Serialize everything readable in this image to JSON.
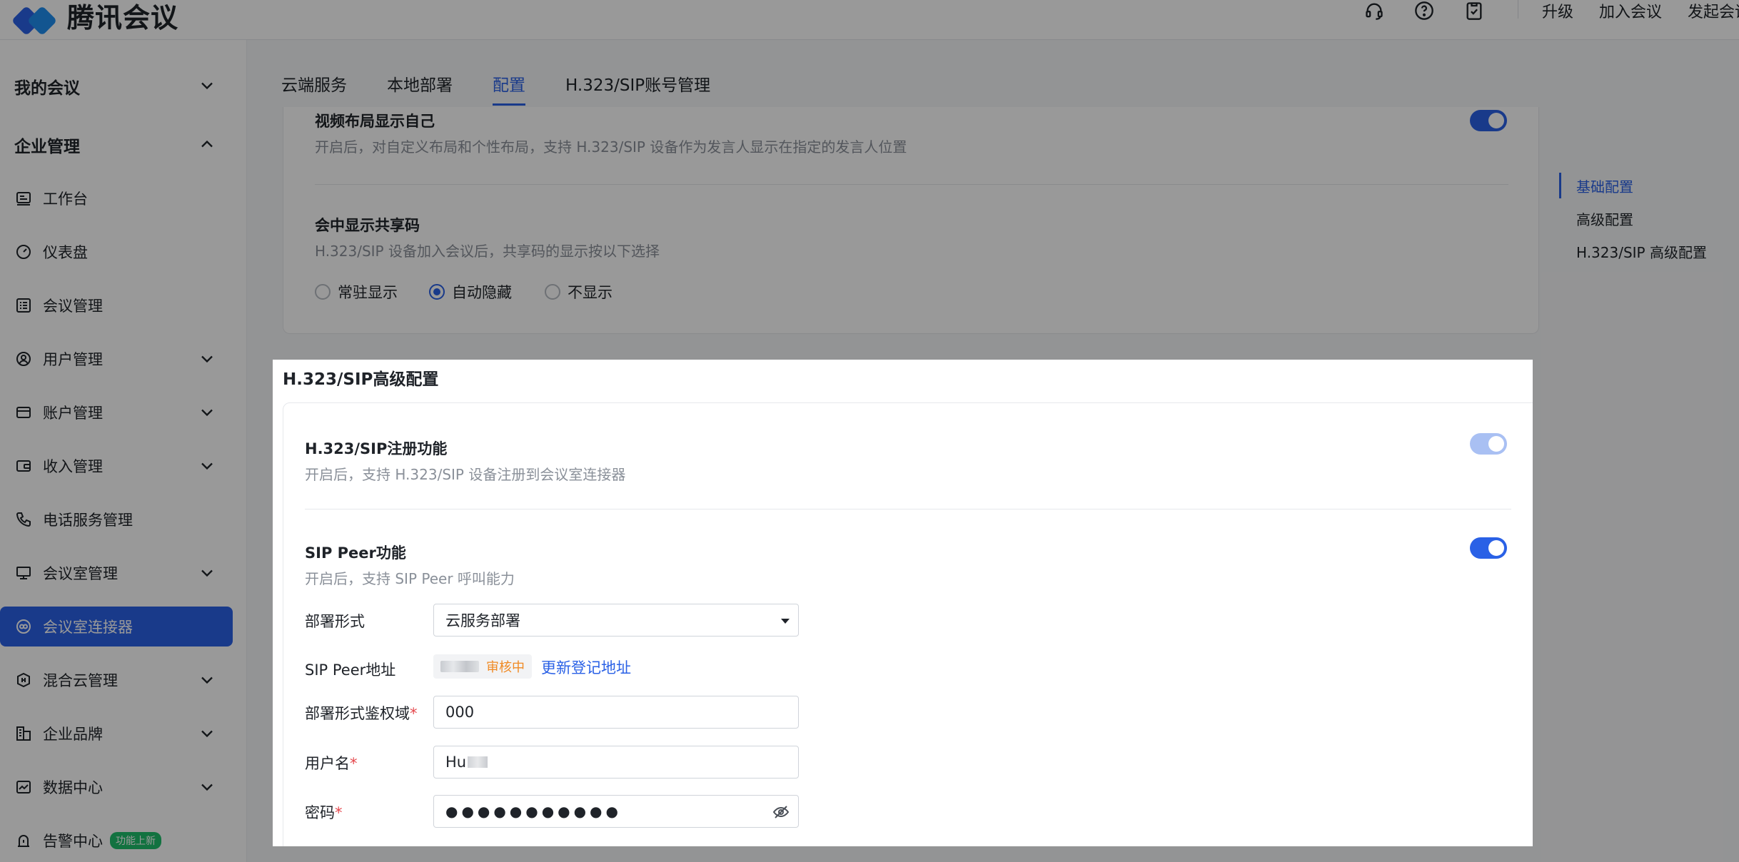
{
  "header": {
    "app_name": "腾讯会议",
    "links": [
      "升级",
      "加入会议",
      "发起会议"
    ],
    "icons": [
      "headset-icon",
      "help-icon",
      "clipboard-check-icon"
    ]
  },
  "sidebar": {
    "section_my": "我的会议",
    "section_enterprise": "企业管理",
    "items": [
      {
        "label": "工作台",
        "icon": "workbench-icon",
        "expandable": false
      },
      {
        "label": "仪表盘",
        "icon": "dashboard-icon",
        "expandable": false
      },
      {
        "label": "会议管理",
        "icon": "list-icon",
        "expandable": false
      },
      {
        "label": "用户管理",
        "icon": "user-icon",
        "expandable": true
      },
      {
        "label": "账户管理",
        "icon": "card-icon",
        "expandable": true
      },
      {
        "label": "收入管理",
        "icon": "wallet-icon",
        "expandable": true
      },
      {
        "label": "电话服务管理",
        "icon": "phone-icon",
        "expandable": false
      },
      {
        "label": "会议室管理",
        "icon": "monitor-icon",
        "expandable": true
      },
      {
        "label": "会议室连接器",
        "icon": "link-icon",
        "expandable": false,
        "active": true
      },
      {
        "label": "混合云管理",
        "icon": "hybrid-cloud-icon",
        "expandable": true
      },
      {
        "label": "企业品牌",
        "icon": "brand-icon",
        "expandable": true
      },
      {
        "label": "数据中心",
        "icon": "chart-icon",
        "expandable": true
      },
      {
        "label": "告警中心",
        "icon": "alarm-icon",
        "expandable": false,
        "badge": "功能上新"
      }
    ]
  },
  "tabs": [
    {
      "label": "云端服务",
      "active": false
    },
    {
      "label": "本地部署",
      "active": false
    },
    {
      "label": "配置",
      "active": true
    },
    {
      "label": "H.323/SIP账号管理",
      "active": false
    }
  ],
  "basic": {
    "video_layout_title": "视频布局显示自己",
    "video_layout_desc": "开启后，对自定义布局和个性布局，支持 H.323/SIP 设备作为发言人显示在指定的发言人位置",
    "video_layout_on": true,
    "share_code_title": "会中显示共享码",
    "share_code_desc": "H.323/SIP 设备加入会议后，共享码的显示按以下选择",
    "share_code_options": [
      "常驻显示",
      "自动隐藏",
      "不显示"
    ],
    "share_code_selected": "自动隐藏"
  },
  "toc": {
    "items": [
      "基础配置",
      "高级配置",
      "H.323/SIP 高级配置"
    ],
    "active": "基础配置"
  },
  "advanced": {
    "section_title": "H.323/SIP高级配置",
    "register_title": "H.323/SIP注册功能",
    "register_desc": "开启后，支持 H.323/SIP 设备注册到会议室连接器",
    "register_on": true,
    "peer_title": "SIP Peer功能",
    "peer_desc": "开启后，支持 SIP Peer 呼叫能力",
    "peer_on": true,
    "deploy_label": "部署形式",
    "deploy_value": "云服务部署",
    "peer_addr_label": "SIP Peer地址",
    "peer_status": "审核中",
    "peer_update_link": "更新登记地址",
    "auth_domain_label": "部署形式鉴权域",
    "auth_domain_value": "000",
    "username_label": "用户名",
    "username_value": "Hu",
    "password_label": "密码",
    "password_dots": "●●●●●●●●●●●",
    "required_mark": "*"
  },
  "colors": {
    "accent": "#2a61e6",
    "pending": "#f08a24",
    "required": "#e5484d"
  }
}
